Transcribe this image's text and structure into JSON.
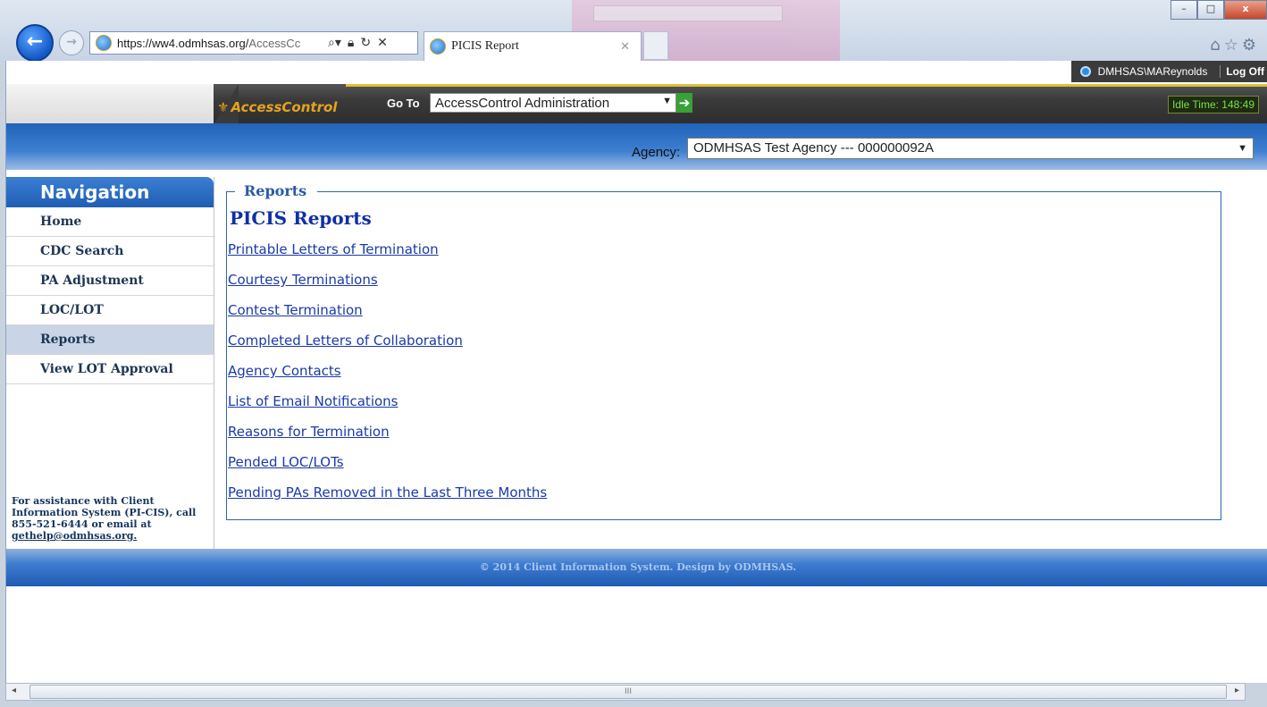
{
  "browser": {
    "url_host": "https://ww4.odmhsas.org/",
    "url_rest": "AccessCc",
    "tab_title": "PICIS Report",
    "window_buttons": {
      "minimize": "–",
      "maximize": "□",
      "close": "x"
    }
  },
  "userbar": {
    "username": "DMHSAS\\MAReynolds",
    "logoff": "Log Off"
  },
  "header": {
    "logo": "AccessControl",
    "goto_label": "Go To",
    "goto_value": "AccessControl Administration",
    "idle": "Idle Time: 148:49"
  },
  "agency": {
    "label": "Agency:",
    "value": "ODMHSAS Test Agency --- 000000092A"
  },
  "nav": {
    "title": "Navigation",
    "items": [
      "Home",
      "CDC Search",
      "PA Adjustment",
      "LOC/LOT",
      "Reports",
      "View LOT Approval"
    ],
    "active": "Reports",
    "assist_text": "For assistance with Client Information System (PI-CIS), call 855-521-6444 or email at",
    "assist_email": "gethelp@odmhsas.org."
  },
  "content": {
    "legend": "Reports",
    "title": "PICIS Reports",
    "links": [
      "Printable Letters of Termination",
      "Courtesy Terminations",
      "Contest Termination",
      "Completed Letters of Collaboration",
      "Agency Contacts",
      "List of Email Notifications",
      "Reasons for Termination",
      "Pended LOC/LOTs",
      "Pending PAs Removed in the Last Three Months"
    ]
  },
  "footer": {
    "text": "© 2014 Client Information System. Design by ODMHSAS."
  },
  "colors": {
    "accent_blue": "#2a66b0",
    "header_gold": "#d9c13a",
    "idle_green": "#79e04b"
  }
}
